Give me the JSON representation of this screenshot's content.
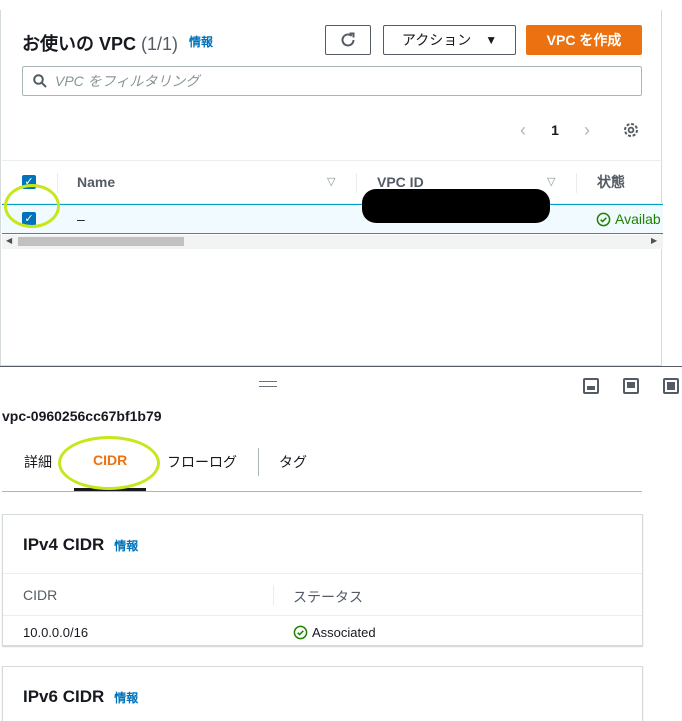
{
  "vpc_list": {
    "title": "お使いの VPC",
    "count": "(1/1)",
    "info": "情報",
    "actions_label": "アクション",
    "create_label": "VPC を作成",
    "search_placeholder": "VPC をフィルタリング",
    "page": "1",
    "columns": [
      "Name",
      "VPC ID",
      "状態"
    ],
    "rows": [
      {
        "name": "–",
        "vpc_id": "",
        "state": "Availab"
      }
    ]
  },
  "detail": {
    "vpc_id": "vpc-0960256cc67bf1b79",
    "tabs": [
      "詳細",
      "CIDR",
      "フローログ",
      "タグ"
    ],
    "active_tab": "CIDR",
    "ipv4": {
      "title": "IPv4 CIDR",
      "info": "情報",
      "columns": [
        "CIDR",
        "ステータス"
      ],
      "rows": [
        {
          "cidr": "10.0.0.0/16",
          "status": "Associated"
        }
      ]
    },
    "ipv6": {
      "title": "IPv6 CIDR",
      "info": "情報"
    }
  },
  "colors": {
    "accent": "#ec7211",
    "link": "#0073bb",
    "success": "#1d8102",
    "highlight": "#c6e71b"
  }
}
